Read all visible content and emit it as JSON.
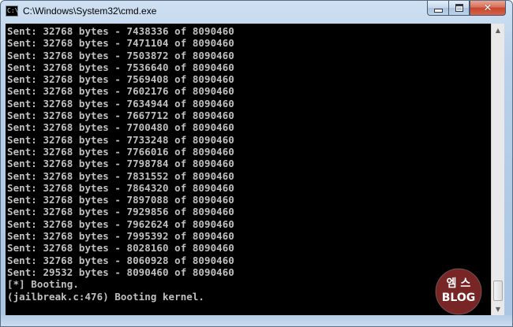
{
  "window": {
    "title": "C:\\Windows\\System32\\cmd.exe",
    "icon": "cmd-icon",
    "controls": {
      "minimize": "minimize-icon",
      "maximize": "maximize-icon",
      "close": "close-icon"
    }
  },
  "console": {
    "lines": [
      "Sent: 32768 bytes - 7438336 of 8090460",
      "Sent: 32768 bytes - 7471104 of 8090460",
      "Sent: 32768 bytes - 7503872 of 8090460",
      "Sent: 32768 bytes - 7536640 of 8090460",
      "Sent: 32768 bytes - 7569408 of 8090460",
      "Sent: 32768 bytes - 7602176 of 8090460",
      "Sent: 32768 bytes - 7634944 of 8090460",
      "Sent: 32768 bytes - 7667712 of 8090460",
      "Sent: 32768 bytes - 7700480 of 8090460",
      "Sent: 32768 bytes - 7733248 of 8090460",
      "Sent: 32768 bytes - 7766016 of 8090460",
      "Sent: 32768 bytes - 7798784 of 8090460",
      "Sent: 32768 bytes - 7831552 of 8090460",
      "Sent: 32768 bytes - 7864320 of 8090460",
      "Sent: 32768 bytes - 7897088 of 8090460",
      "Sent: 32768 bytes - 7929856 of 8090460",
      "Sent: 32768 bytes - 7962624 of 8090460",
      "Sent: 32768 bytes - 7995392 of 8090460",
      "Sent: 32768 bytes - 8028160 of 8090460",
      "Sent: 32768 bytes - 8060928 of 8090460",
      "Sent: 29532 bytes - 8090460 of 8090460",
      "[*] Booting.",
      "(jailbreak.c:476) Booting kernel."
    ],
    "text_color": "#c0c0c0",
    "background": "#000000"
  },
  "scrollbar": {
    "up_icon": "scroll-up-arrow-icon",
    "down_icon": "scroll-down-arrow-icon"
  },
  "watermark": {
    "line1": "엠 스",
    "line2": "BLOG",
    "color": "#8c2b2b"
  }
}
